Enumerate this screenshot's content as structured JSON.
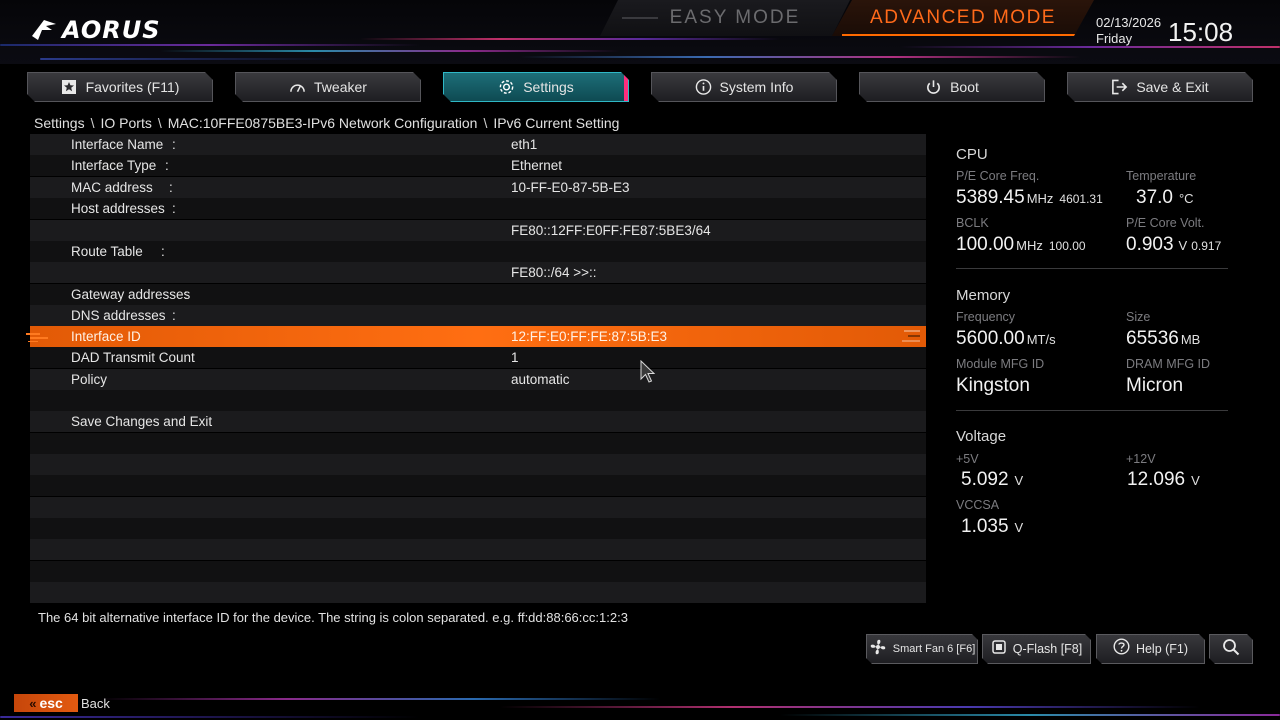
{
  "brand": {
    "logo_text": "AORUS"
  },
  "modes": {
    "easy": "EASY MODE",
    "advanced": "ADVANCED MODE"
  },
  "clock": {
    "date": "02/13/2026",
    "day": "Friday",
    "time": "15:08"
  },
  "tabs": [
    {
      "label": "Favorites (F11)",
      "icon": "star-icon"
    },
    {
      "label": "Tweaker",
      "icon": "gauge-icon"
    },
    {
      "label": "Settings",
      "icon": "gear-icon",
      "active": true
    },
    {
      "label": "System Info",
      "icon": "info-icon"
    },
    {
      "label": "Boot",
      "icon": "power-icon"
    },
    {
      "label": "Save & Exit",
      "icon": "exit-icon"
    }
  ],
  "breadcrumb": [
    "Settings",
    "IO Ports",
    "MAC:10FFE0875BE3-IPv6 Network Configuration",
    "IPv6 Current Setting"
  ],
  "breadcrumb_sep": "\\",
  "rows": [
    {
      "name": "Interface Name",
      "colon": ":",
      "value": "eth1"
    },
    {
      "name": "Interface Type",
      "colon": ":",
      "value": "Ethernet"
    },
    {
      "name": "MAC address",
      "colon": ":",
      "value": "10-FF-E0-87-5B-E3"
    },
    {
      "name": "Host addresses",
      "colon": ":",
      "value": ""
    },
    {
      "name": "",
      "colon": "",
      "value": "FE80::12FF:E0FF:FE87:5BE3/64"
    },
    {
      "name": "Route Table",
      "colon": ":",
      "value": ""
    },
    {
      "name": "",
      "colon": "",
      "value": "FE80::/64 >>::"
    },
    {
      "name": "Gateway addresses",
      "colon": ":",
      "value": ""
    },
    {
      "name": "DNS addresses",
      "colon": ":",
      "value": ""
    },
    {
      "name": "Interface ID",
      "colon": "",
      "value": "12:FF:E0:FF:FE:87:5B:E3",
      "selected": true
    },
    {
      "name": "DAD Transmit Count",
      "colon": "",
      "value": "1"
    },
    {
      "name": "Policy",
      "colon": "",
      "value": "automatic"
    },
    {
      "name": "",
      "colon": "",
      "value": ""
    },
    {
      "name": "Save Changes and Exit",
      "colon": "",
      "value": ""
    }
  ],
  "help_text": "The 64 bit alternative interface ID for the device. The string is colon separated. e.g. ff:dd:88:66:cc:1:2:3",
  "cpu": {
    "title": "CPU",
    "freq_label": "P/E Core Freq.",
    "freq_value": "5389.45",
    "freq_unit": "MHz",
    "freq_sub": "4601.31",
    "temp_label": "Temperature",
    "temp_value": "37.0",
    "temp_unit": "°C",
    "bclk_label": "BCLK",
    "bclk_value": "100.00",
    "bclk_unit": "MHz",
    "bclk_sub": "100.00",
    "volt_label": "P/E Core Volt.",
    "volt_value": "0.903",
    "volt_unit": "V",
    "volt_sub": "0.917"
  },
  "memory": {
    "title": "Memory",
    "freq_label": "Frequency",
    "freq_value": "5600.00",
    "freq_unit": "MT/s",
    "size_label": "Size",
    "size_value": "65536",
    "size_unit": "MB",
    "module_label": "Module MFG ID",
    "module_value": "Kingston",
    "dram_label": "DRAM MFG ID",
    "dram_value": "Micron"
  },
  "voltage": {
    "title": "Voltage",
    "v5_label": "+5V",
    "v5_value": "5.092",
    "v5_unit": "V",
    "v12_label": "+12V",
    "v12_value": "12.096",
    "v12_unit": "V",
    "vccsa_label": "VCCSA",
    "vccsa_value": "1.035",
    "vccsa_unit": "V"
  },
  "bottom_buttons": [
    {
      "label": "Smart Fan 6 [F6]",
      "icon": "fan-icon"
    },
    {
      "label": "Q-Flash [F8]",
      "icon": "chip-icon"
    },
    {
      "label": "Help (F1)",
      "icon": "help-icon"
    },
    {
      "label": "",
      "icon": "search-icon"
    }
  ],
  "footer": {
    "esc": "esc",
    "back": "Back"
  },
  "colors": {
    "accent": "#ff6a00",
    "active_tab": "#1d6e78",
    "selected_row": "#f0640e"
  }
}
